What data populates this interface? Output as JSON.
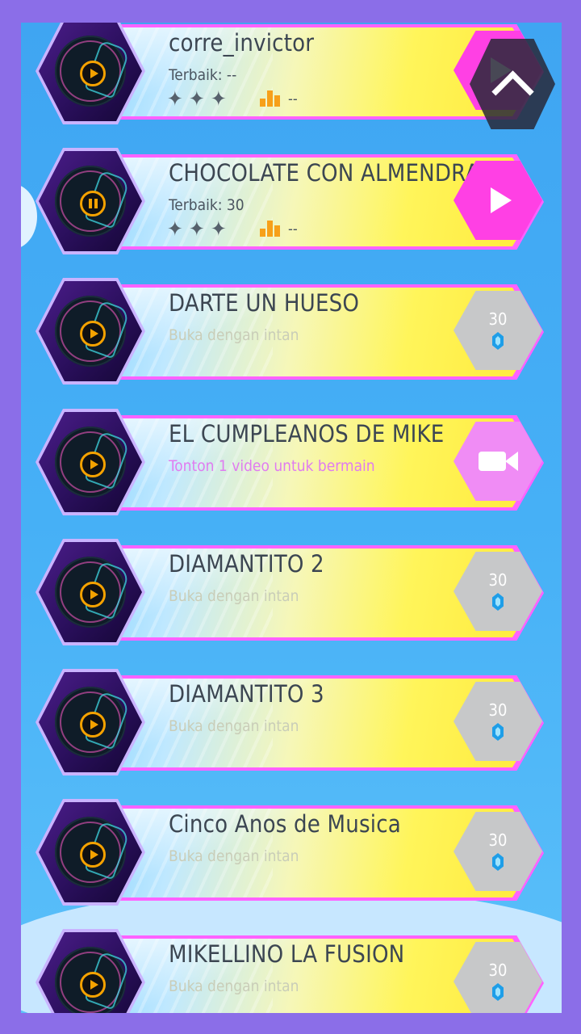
{
  "songs": [
    {
      "title": "corre_invictor",
      "subtitle": "Terbaik: --",
      "state": "played",
      "stars": "✦ ✦ ✦",
      "rank": "--",
      "action": "play"
    },
    {
      "title": "CHOCOLATE CON ALMENDRAS",
      "subtitle": "Terbaik: 30",
      "state": "played",
      "stars": "✦ ✦ ✦",
      "rank": "--",
      "action": "play"
    },
    {
      "title": "DARTE UN HUESO",
      "subtitle": "Buka dengan intan",
      "state": "locked",
      "cost": "30",
      "action": "unlock"
    },
    {
      "title": "EL CUMPLEANOS DE MIKE",
      "subtitle": "Tonton 1 video untuk bermain",
      "state": "video",
      "action": "watch-video"
    },
    {
      "title": "DIAMANTITO 2",
      "subtitle": "Buka dengan intan",
      "state": "locked",
      "cost": "30",
      "action": "unlock"
    },
    {
      "title": "DIAMANTITO 3",
      "subtitle": "Buka dengan intan",
      "state": "locked",
      "cost": "30",
      "action": "unlock"
    },
    {
      "title": "Cinco Anos de Musica",
      "subtitle": "Buka dengan intan",
      "state": "locked",
      "cost": "30",
      "action": "unlock"
    },
    {
      "title": "MIKELLINO LA FUSION",
      "subtitle": "Buka dengan intan",
      "state": "locked",
      "cost": "30",
      "action": "unlock"
    }
  ],
  "colors": {
    "frame": "#8b6ee8",
    "play_accent": "#f5a200",
    "pink_button": "#ff40e4",
    "video_button": "#f08cf5",
    "cost_badge": "#c7c8c9",
    "gem": "#1e9ee8"
  },
  "icons": {
    "disc": "vinyl-disc-icon",
    "play": "play-icon",
    "pause": "pause-icon",
    "video": "video-camera-icon",
    "gem": "diamond-gem-icon",
    "scroll": "chevron-up-icon"
  }
}
